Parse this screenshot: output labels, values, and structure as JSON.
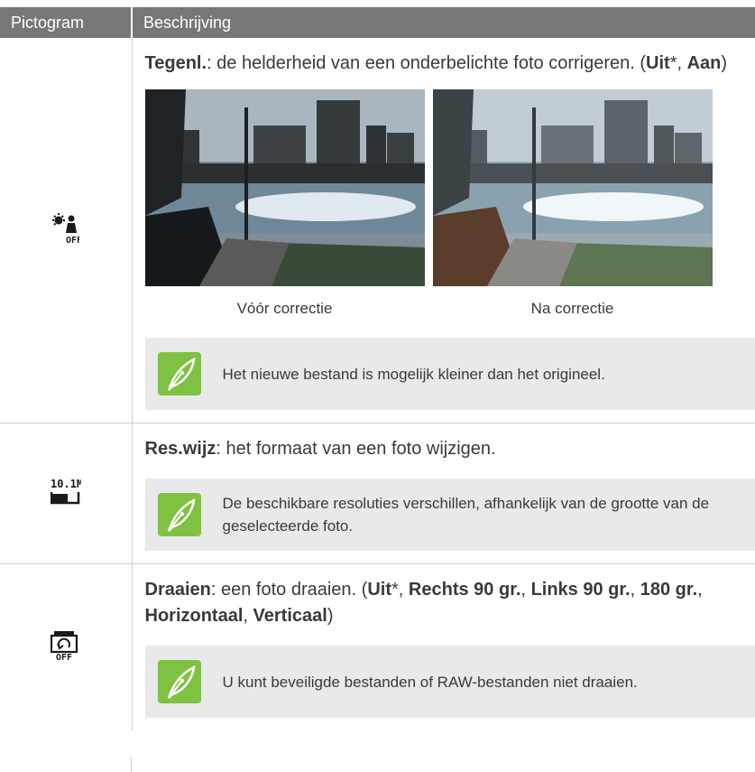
{
  "header": {
    "col1": "Pictogram",
    "col2": "Beschrijving"
  },
  "rows": [
    {
      "icon": "backlight-off-icon",
      "term": "Tegenl.",
      "desc": ": de helderheid van een onderbelichte foto corrigeren. (",
      "opt1": "Uit",
      "star": "*",
      "sep": ", ",
      "opt2": "Aan",
      "close": ")",
      "caption_before": "Vóór correctie",
      "caption_after": "Na correctie",
      "note": "Het nieuwe bestand is mogelijk kleiner dan het origineel."
    },
    {
      "icon": "resize-icon",
      "icon_text": "10.1M",
      "term": "Res.wijz",
      "desc": ": het formaat van een foto wijzigen.",
      "note": "De beschikbare resoluties verschillen, afhankelijk van de grootte van de geselecteerde foto."
    },
    {
      "icon": "rotate-off-icon",
      "term": "Draaien",
      "desc": ": een foto draaien. (",
      "opt1": "Uit",
      "star": "*",
      "sep1": ", ",
      "opt2": "Rechts 90 gr.",
      "sep2": ", ",
      "opt3": "Links 90 gr.",
      "sep3": ", ",
      "opt4": "180 gr.",
      "sep4": ", ",
      "opt5": "Horizontaal",
      "sep5": ", ",
      "opt6": "Verticaal",
      "close": ")",
      "note": "U kunt beveiligde bestanden of RAW-bestanden niet draaien."
    }
  ]
}
